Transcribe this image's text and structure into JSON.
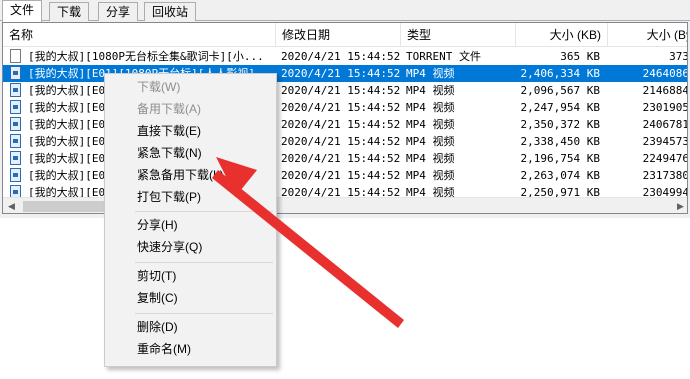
{
  "tabs": [
    "文件",
    "下载",
    "分享",
    "回收站"
  ],
  "columns": {
    "name": "名称",
    "date": "修改日期",
    "type": "类型",
    "size": "大小 (KB)",
    "size2": "大小 (By"
  },
  "rows": [
    {
      "icon": "file-icon",
      "name": "[我的大叔][1080P无台标全集&歌词卡][小...",
      "date": "2020/4/21 15:44:52",
      "type": "TORRENT 文件",
      "size": "365 KB",
      "size2": "373"
    },
    {
      "icon": "mp4-icon",
      "name": "[我的大叔][E01][1080P无台标][人人影视]",
      "date": "2020/4/21 15:44:52",
      "type": "MP4 视频",
      "size": "2,406,334 KB",
      "size2": "2464086"
    },
    {
      "icon": "mp4-icon",
      "name": "[我的大叔][E0",
      "date": "2020/4/21 15:44:52",
      "type": "MP4 视频",
      "size": "2,096,567 KB",
      "size2": "2146884"
    },
    {
      "icon": "mp4-icon",
      "name": "[我的大叔][E0",
      "date": "2020/4/21 15:44:52",
      "type": "MP4 视频",
      "size": "2,247,954 KB",
      "size2": "2301905"
    },
    {
      "icon": "mp4-icon",
      "name": "[我的大叔][E0",
      "date": "2020/4/21 15:44:52",
      "type": "MP4 视频",
      "size": "2,350,372 KB",
      "size2": "2406781"
    },
    {
      "icon": "mp4-icon",
      "name": "[我的大叔][E0",
      "date": "2020/4/21 15:44:52",
      "type": "MP4 视频",
      "size": "2,338,450 KB",
      "size2": "2394573"
    },
    {
      "icon": "mp4-icon",
      "name": "[我的大叔][E0",
      "date": "2020/4/21 15:44:52",
      "type": "MP4 视频",
      "size": "2,196,754 KB",
      "size2": "2249476"
    },
    {
      "icon": "mp4-icon",
      "name": "[我的大叔][E0",
      "date": "2020/4/21 15:44:52",
      "type": "MP4 视频",
      "size": "2,263,074 KB",
      "size2": "2317380"
    },
    {
      "icon": "mp4-icon",
      "name": "[我的大叔][E0",
      "date": "2020/4/21 15:44:52",
      "type": "MP4 视频",
      "size": "2,250,971 KB",
      "size2": "2304994"
    }
  ],
  "menu": {
    "download": "下载(W)",
    "backup_download": "备用下载(A)",
    "direct_download": "直接下载(E)",
    "urgent_download": "紧急下载(N)",
    "urgent_backup_download": "紧急备用下载(L)",
    "pack_download": "打包下载(P)",
    "share": "分享(H)",
    "quick_share": "快速分享(Q)",
    "cut": "剪切(T)",
    "copy": "复制(C)",
    "delete": "删除(D)",
    "rename": "重命名(M)"
  },
  "colors": {
    "selection": "#0078d7",
    "arrow": "#e8302f"
  }
}
